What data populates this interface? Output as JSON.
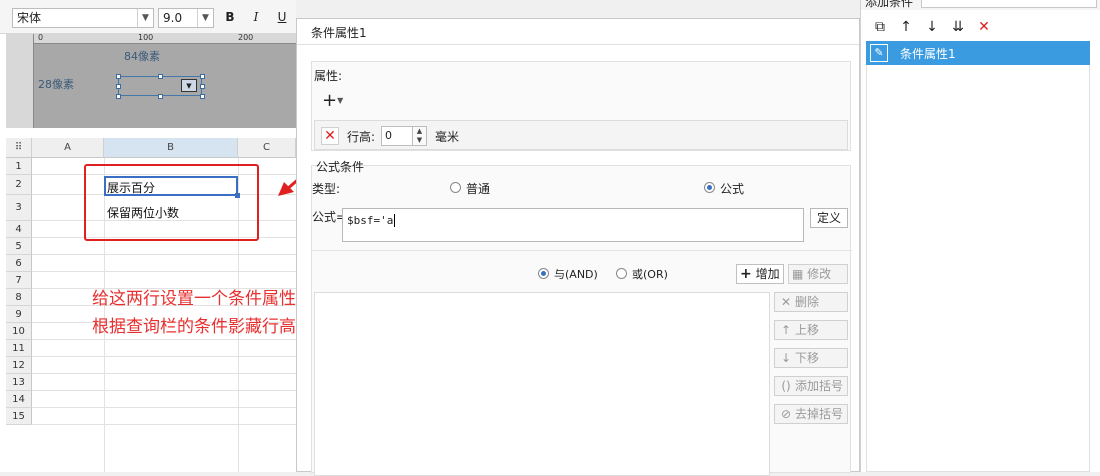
{
  "toolbar": {
    "font_name": "宋体",
    "font_size": "9.0",
    "bold": "B",
    "italic": "I",
    "underline": "U"
  },
  "designer": {
    "ruler_marks": [
      "0",
      "100",
      "200"
    ],
    "width_label": "84像素",
    "height_label": "28像素"
  },
  "sheet": {
    "columns": [
      "A",
      "B",
      "C"
    ],
    "rows": [
      "1",
      "2",
      "3",
      "4",
      "5",
      "6",
      "7",
      "8",
      "9",
      "10",
      "11",
      "12",
      "13",
      "14",
      "15"
    ],
    "cell_b2": "展示百分",
    "cell_b3": "保留两位小数"
  },
  "annotation": {
    "line1": "给这两行设置一个条件属性",
    "line2": "根据查询栏的条件影藏行高"
  },
  "dialog": {
    "title": "条件属性1",
    "attr_section": "属性:",
    "add_icon": "+",
    "row_height_label": "行高:",
    "row_height_value": "0",
    "row_height_unit": "毫米",
    "formula_section": "公式条件",
    "type_label": "类型:",
    "type_normal": "普通",
    "type_formula": "公式",
    "type_selected": "公式",
    "formula_label": "公式=",
    "formula_value": "$bsf='a",
    "define_button": "定义",
    "and_label": "与(AND)",
    "or_label": "或(OR)",
    "add_button": "增加",
    "edit_button": "修改",
    "delete_button": "删除",
    "move_up_button": "上移",
    "move_down_button": "下移",
    "add_bracket_button": "添加括号",
    "remove_bracket_button": "去掉括号"
  },
  "right_panel": {
    "top_label": "添加条件",
    "condition_items": [
      "条件属性1"
    ]
  },
  "colors": {
    "accent_red": "#e02020",
    "selection_blue": "#3a9be0"
  }
}
